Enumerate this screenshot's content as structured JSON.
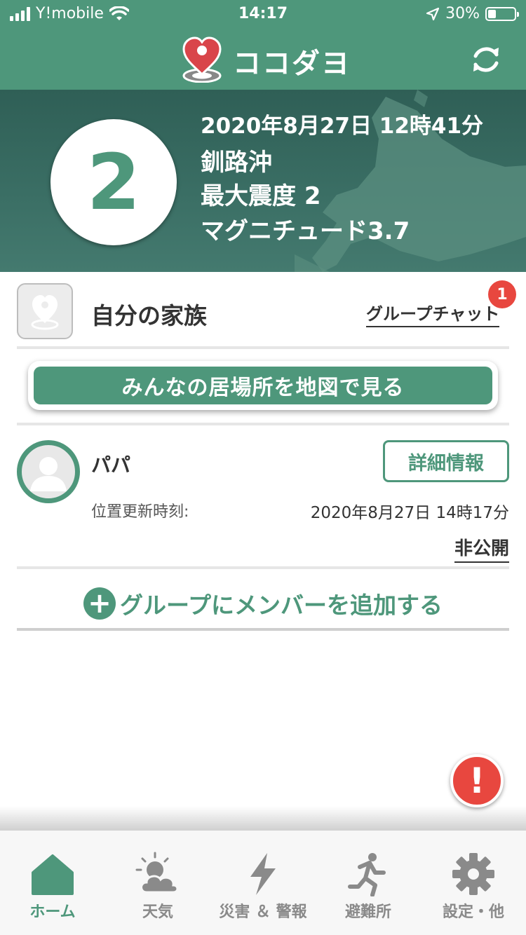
{
  "status_bar": {
    "carrier": "Y!mobile",
    "time": "14:17",
    "battery": "30%",
    "battery_level": 0.3
  },
  "header": {
    "title": "ココダヨ"
  },
  "earthquake": {
    "intensity": "2",
    "datetime": "2020年8月27日 12時41分",
    "location": "釧路沖",
    "max_intensity": "最大震度 2",
    "magnitude": "マグニチュード3.7"
  },
  "group": {
    "name": "自分の家族",
    "chat_label": "グループチャット",
    "chat_badge": "1",
    "map_button": "みんなの居場所を地図で見る"
  },
  "members": [
    {
      "name": "パパ",
      "detail_button": "詳細情報",
      "update_label": "位置更新時刻:",
      "update_time": "2020年8月27日 14時17分",
      "visibility": "非公開"
    }
  ],
  "add_member": {
    "label": "グループにメンバーを追加する"
  },
  "tabs": [
    {
      "label": "ホーム",
      "icon": "home-icon",
      "active": true
    },
    {
      "label": "天気",
      "icon": "weather-icon",
      "active": false
    },
    {
      "label": "災害 ＆ 警報",
      "icon": "lightning-icon",
      "active": false
    },
    {
      "label": "避難所",
      "icon": "running-person-icon",
      "active": false
    },
    {
      "label": "設定・他",
      "icon": "gear-icon",
      "active": false
    }
  ],
  "colors": {
    "brand_green": "#4e977b",
    "banner_dark": "#2f5f56",
    "alert_red": "#e8473f",
    "inactive_grey": "#8a8a8a"
  }
}
